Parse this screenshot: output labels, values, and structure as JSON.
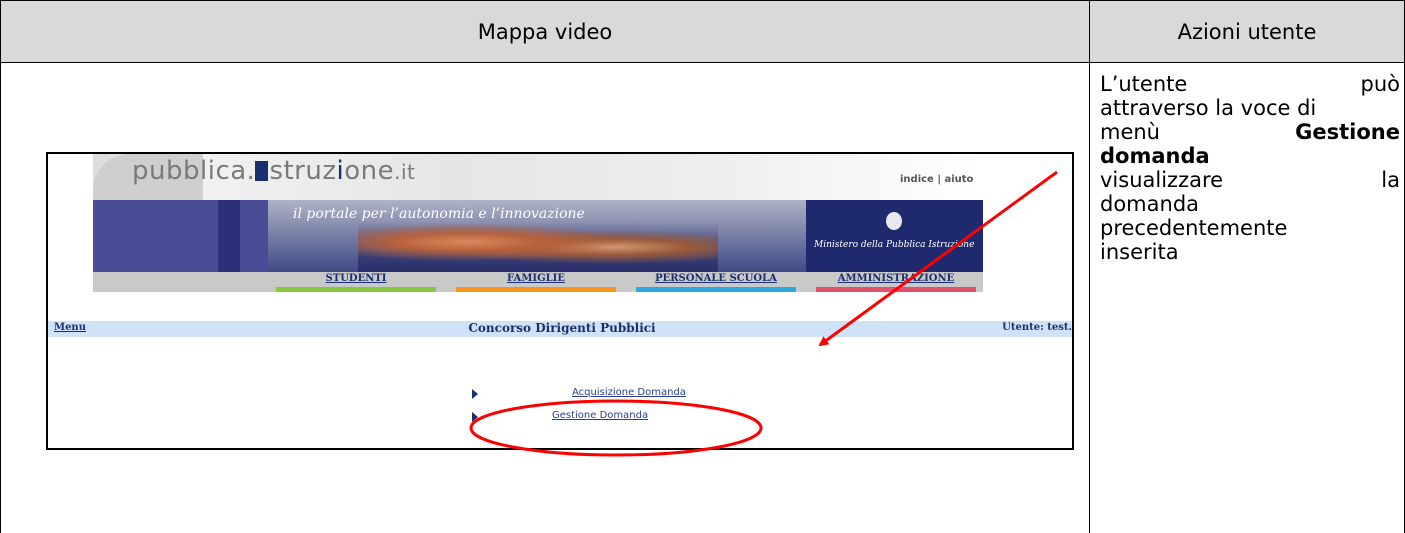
{
  "table": {
    "left_header": "Mappa video",
    "right_header": "Azioni utente"
  },
  "actions": {
    "line1_word1": "L’utente",
    "line1_word2": "può",
    "line2": "attraverso la voce di",
    "line3_word1": "menù",
    "line3_bold": "Gestione",
    "line4_bold": "domanda",
    "line5_word1": "visualizzare",
    "line5_word2": "la",
    "line6": "domanda",
    "line7": "precedentemente",
    "line8": "inserita"
  },
  "portal": {
    "logo_prefix": "pubblica.",
    "logo_i": "i",
    "logo_str": "struz",
    "logo_i2": "i",
    "logo_one": "one",
    "logo_suffix": ".it",
    "top_links": "indice | aiuto",
    "tagline": "il portale per l’autonomia e l’innovazione",
    "ministry": "Ministero della Pubblica Istruzione",
    "nav": [
      {
        "label": "STUDENTI",
        "color": "#8cc63f"
      },
      {
        "label": "FAMIGLIE",
        "color": "#f7941d"
      },
      {
        "label": "PERSONALE SCUOLA",
        "color": "#29abe2"
      },
      {
        "label": "AMMINISTRAZIONE",
        "color": "#e0516a"
      }
    ]
  },
  "page": {
    "menu_link": "Menu",
    "title": "Concorso Dirigenti Pubblici",
    "user": "Utente: test."
  },
  "menu": [
    {
      "label": "Acquisizione Domanda"
    },
    {
      "label": "Gestione Domanda"
    }
  ],
  "annotation_color": "#ff0000"
}
